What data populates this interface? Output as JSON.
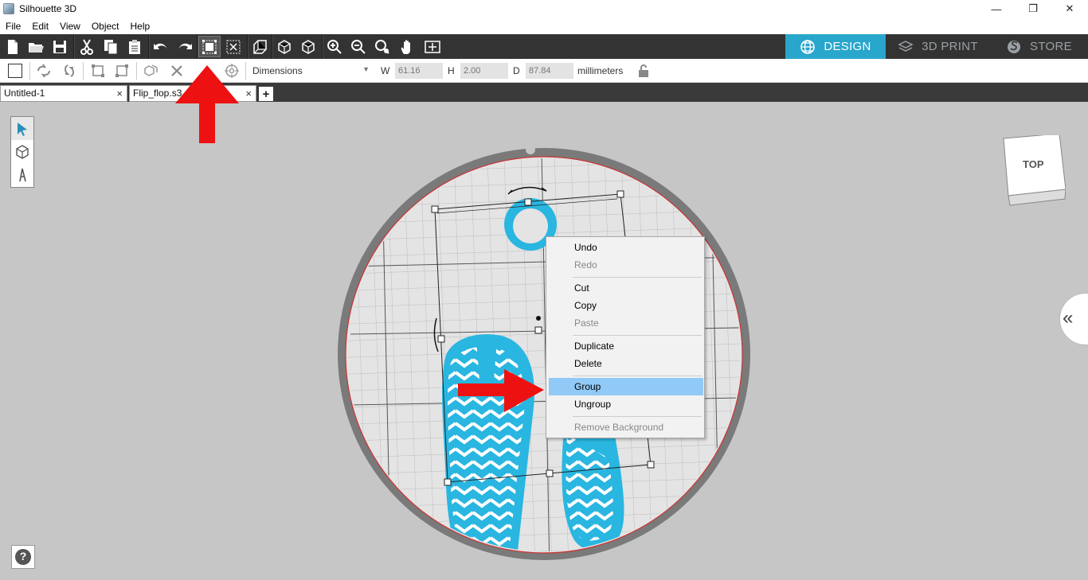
{
  "app": {
    "title": "Silhouette 3D"
  },
  "window": {
    "minimize": "—",
    "restore": "❐",
    "close": "✕"
  },
  "menu": [
    "File",
    "Edit",
    "View",
    "Object",
    "Help"
  ],
  "modes": {
    "design": "DESIGN",
    "print": "3D PRINT",
    "store": "STORE",
    "active": "DESIGN"
  },
  "properties": {
    "dimensions_select": "Dimensions",
    "w_label": "W",
    "w_value": "61.16",
    "h_label": "H",
    "h_value": "2.00",
    "d_label": "D",
    "d_value": "87.84",
    "unit": "millimeters"
  },
  "tabs": [
    {
      "label": "Untitled-1",
      "close": "×"
    },
    {
      "label": "Flip_flop.s3",
      "close": "×"
    }
  ],
  "add_tab": "+",
  "viewcube": {
    "label": "TOP"
  },
  "help": "?",
  "collapse_icon": "«",
  "context_menu": {
    "items": [
      {
        "label": "Undo",
        "enabled": true
      },
      {
        "label": "Redo",
        "enabled": false
      },
      {
        "label": "Cut",
        "enabled": true
      },
      {
        "label": "Copy",
        "enabled": true
      },
      {
        "label": "Paste",
        "enabled": false
      },
      {
        "label": "Duplicate",
        "enabled": true
      },
      {
        "label": "Delete",
        "enabled": true
      },
      {
        "label": "Group",
        "enabled": true,
        "highlighted": true
      },
      {
        "label": "Ungroup",
        "enabled": true
      },
      {
        "label": "Remove Background",
        "enabled": false
      }
    ]
  },
  "colors": {
    "accent": "#28a6cc",
    "model": "#29b6e0",
    "annotation_arrow": "#ee1111",
    "toolbar": "#333333",
    "menu_highlight": "#91c9f7"
  }
}
